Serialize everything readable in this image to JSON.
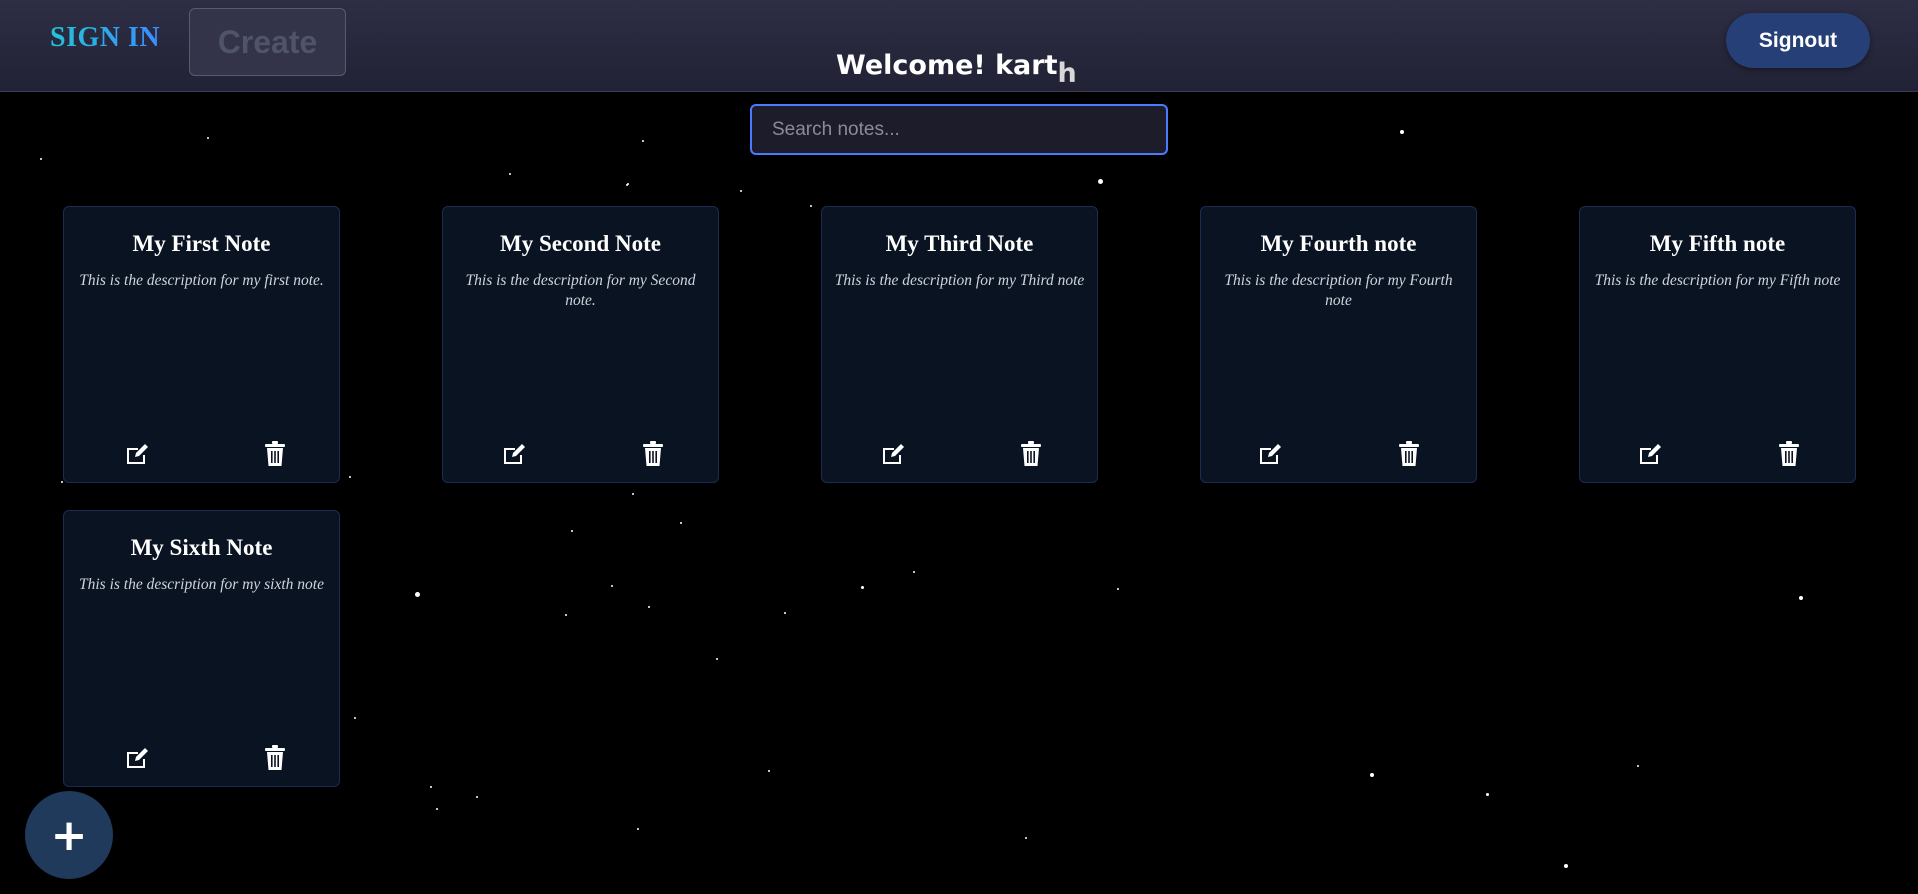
{
  "header": {
    "signin_label": "SIGN IN",
    "create_label": "Create",
    "welcome_prefix": "Welcome! kart",
    "welcome_suffix": "h",
    "signout_label": "Signout"
  },
  "search": {
    "placeholder": "Search notes...",
    "value": ""
  },
  "notes": [
    {
      "title": "My First Note",
      "description": "This is the description for my first note."
    },
    {
      "title": "My Second Note",
      "description": "This is the description for my Second note."
    },
    {
      "title": "My Third Note",
      "description": "This is the description for my Third note"
    },
    {
      "title": "My Fourth note",
      "description": "This is the description for my Fourth note"
    },
    {
      "title": "My Fifth note",
      "description": "This is the description for my Fifth note"
    },
    {
      "title": "My Sixth Note",
      "description": "This is the description for my sixth note"
    }
  ],
  "icons": {
    "edit": "edit-icon",
    "delete": "trash-icon",
    "add": "plus-icon"
  },
  "fab": {
    "label": "+"
  },
  "colors": {
    "background": "#000000",
    "header": "#2a2a40",
    "card": "#0a1322",
    "card_border": "#1b2c52",
    "signout": "#263f77",
    "search_border": "#4a7bff",
    "fab": "#203a5c"
  }
}
